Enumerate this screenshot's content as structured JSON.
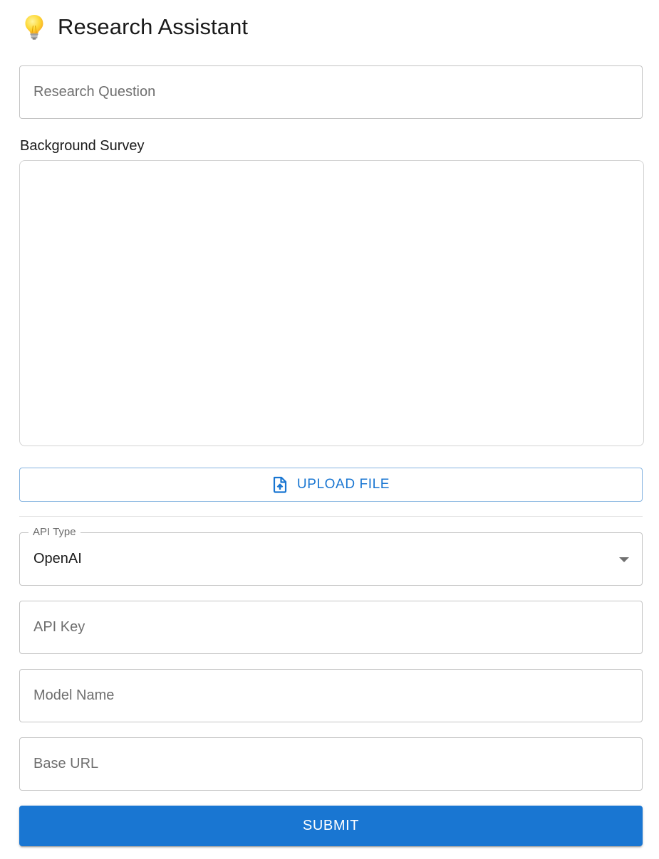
{
  "header": {
    "icon": "lightbulb-icon",
    "title": "Research Assistant"
  },
  "research_question": {
    "value": "",
    "placeholder": "Research Question"
  },
  "background_survey": {
    "label": "Background Survey",
    "value": ""
  },
  "upload": {
    "icon": "file-upload-icon",
    "label": "UPLOAD FILE"
  },
  "api_type": {
    "label": "API Type",
    "selected": "OpenAI",
    "icon": "chevron-down-icon"
  },
  "api_key": {
    "value": "",
    "placeholder": "API Key"
  },
  "model_name": {
    "value": "",
    "placeholder": "Model Name"
  },
  "base_url": {
    "value": "",
    "placeholder": "Base URL"
  },
  "submit": {
    "label": "SUBMIT"
  },
  "colors": {
    "primary": "#1976d2",
    "border": "#c4c4c4",
    "bulb": "#fbc02d"
  }
}
